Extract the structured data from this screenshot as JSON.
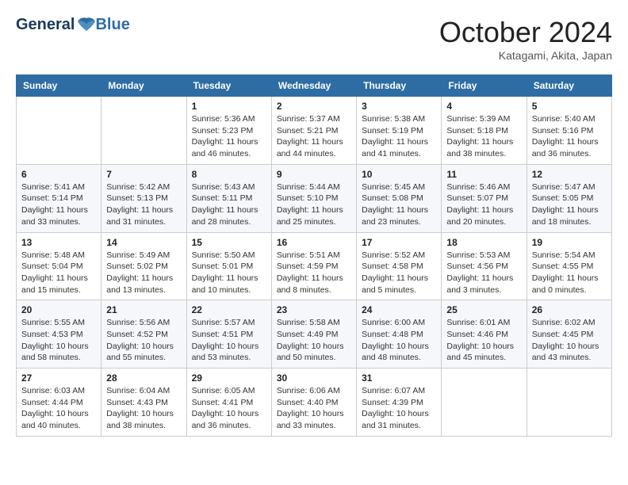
{
  "logo": {
    "line1": "General",
    "line2": "Blue"
  },
  "title": "October 2024",
  "subtitle": "Katagami, Akita, Japan",
  "weekdays": [
    "Sunday",
    "Monday",
    "Tuesday",
    "Wednesday",
    "Thursday",
    "Friday",
    "Saturday"
  ],
  "weeks": [
    [
      {
        "day": "",
        "info": ""
      },
      {
        "day": "",
        "info": ""
      },
      {
        "day": "1",
        "info": "Sunrise: 5:36 AM\nSunset: 5:23 PM\nDaylight: 11 hours and 46 minutes."
      },
      {
        "day": "2",
        "info": "Sunrise: 5:37 AM\nSunset: 5:21 PM\nDaylight: 11 hours and 44 minutes."
      },
      {
        "day": "3",
        "info": "Sunrise: 5:38 AM\nSunset: 5:19 PM\nDaylight: 11 hours and 41 minutes."
      },
      {
        "day": "4",
        "info": "Sunrise: 5:39 AM\nSunset: 5:18 PM\nDaylight: 11 hours and 38 minutes."
      },
      {
        "day": "5",
        "info": "Sunrise: 5:40 AM\nSunset: 5:16 PM\nDaylight: 11 hours and 36 minutes."
      }
    ],
    [
      {
        "day": "6",
        "info": "Sunrise: 5:41 AM\nSunset: 5:14 PM\nDaylight: 11 hours and 33 minutes."
      },
      {
        "day": "7",
        "info": "Sunrise: 5:42 AM\nSunset: 5:13 PM\nDaylight: 11 hours and 31 minutes."
      },
      {
        "day": "8",
        "info": "Sunrise: 5:43 AM\nSunset: 5:11 PM\nDaylight: 11 hours and 28 minutes."
      },
      {
        "day": "9",
        "info": "Sunrise: 5:44 AM\nSunset: 5:10 PM\nDaylight: 11 hours and 25 minutes."
      },
      {
        "day": "10",
        "info": "Sunrise: 5:45 AM\nSunset: 5:08 PM\nDaylight: 11 hours and 23 minutes."
      },
      {
        "day": "11",
        "info": "Sunrise: 5:46 AM\nSunset: 5:07 PM\nDaylight: 11 hours and 20 minutes."
      },
      {
        "day": "12",
        "info": "Sunrise: 5:47 AM\nSunset: 5:05 PM\nDaylight: 11 hours and 18 minutes."
      }
    ],
    [
      {
        "day": "13",
        "info": "Sunrise: 5:48 AM\nSunset: 5:04 PM\nDaylight: 11 hours and 15 minutes."
      },
      {
        "day": "14",
        "info": "Sunrise: 5:49 AM\nSunset: 5:02 PM\nDaylight: 11 hours and 13 minutes."
      },
      {
        "day": "15",
        "info": "Sunrise: 5:50 AM\nSunset: 5:01 PM\nDaylight: 11 hours and 10 minutes."
      },
      {
        "day": "16",
        "info": "Sunrise: 5:51 AM\nSunset: 4:59 PM\nDaylight: 11 hours and 8 minutes."
      },
      {
        "day": "17",
        "info": "Sunrise: 5:52 AM\nSunset: 4:58 PM\nDaylight: 11 hours and 5 minutes."
      },
      {
        "day": "18",
        "info": "Sunrise: 5:53 AM\nSunset: 4:56 PM\nDaylight: 11 hours and 3 minutes."
      },
      {
        "day": "19",
        "info": "Sunrise: 5:54 AM\nSunset: 4:55 PM\nDaylight: 11 hours and 0 minutes."
      }
    ],
    [
      {
        "day": "20",
        "info": "Sunrise: 5:55 AM\nSunset: 4:53 PM\nDaylight: 10 hours and 58 minutes."
      },
      {
        "day": "21",
        "info": "Sunrise: 5:56 AM\nSunset: 4:52 PM\nDaylight: 10 hours and 55 minutes."
      },
      {
        "day": "22",
        "info": "Sunrise: 5:57 AM\nSunset: 4:51 PM\nDaylight: 10 hours and 53 minutes."
      },
      {
        "day": "23",
        "info": "Sunrise: 5:58 AM\nSunset: 4:49 PM\nDaylight: 10 hours and 50 minutes."
      },
      {
        "day": "24",
        "info": "Sunrise: 6:00 AM\nSunset: 4:48 PM\nDaylight: 10 hours and 48 minutes."
      },
      {
        "day": "25",
        "info": "Sunrise: 6:01 AM\nSunset: 4:46 PM\nDaylight: 10 hours and 45 minutes."
      },
      {
        "day": "26",
        "info": "Sunrise: 6:02 AM\nSunset: 4:45 PM\nDaylight: 10 hours and 43 minutes."
      }
    ],
    [
      {
        "day": "27",
        "info": "Sunrise: 6:03 AM\nSunset: 4:44 PM\nDaylight: 10 hours and 40 minutes."
      },
      {
        "day": "28",
        "info": "Sunrise: 6:04 AM\nSunset: 4:43 PM\nDaylight: 10 hours and 38 minutes."
      },
      {
        "day": "29",
        "info": "Sunrise: 6:05 AM\nSunset: 4:41 PM\nDaylight: 10 hours and 36 minutes."
      },
      {
        "day": "30",
        "info": "Sunrise: 6:06 AM\nSunset: 4:40 PM\nDaylight: 10 hours and 33 minutes."
      },
      {
        "day": "31",
        "info": "Sunrise: 6:07 AM\nSunset: 4:39 PM\nDaylight: 10 hours and 31 minutes."
      },
      {
        "day": "",
        "info": ""
      },
      {
        "day": "",
        "info": ""
      }
    ]
  ]
}
